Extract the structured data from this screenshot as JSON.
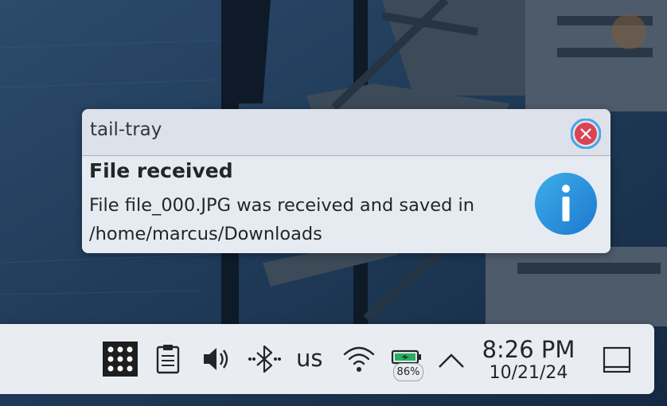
{
  "notification": {
    "app_name": "tail-tray",
    "title": "File received",
    "message": "File file_000.JPG was received and saved in /home/marcus/Downloads",
    "close_icon": "close-icon",
    "info_icon": "information-icon"
  },
  "panel": {
    "launcher_icon": "app-launcher-icon",
    "clipboard_icon": "clipboard-icon",
    "volume_icon": "volume-icon",
    "bluetooth_icon": "bluetooth-icon",
    "keyboard_layout": "us",
    "wifi_icon": "wifi-icon",
    "battery": {
      "percent_label": "86%",
      "charging": true
    },
    "expand_icon": "chevron-up-icon",
    "clock": {
      "time": "8:26 PM",
      "date": "10/21/24"
    },
    "show_desktop_icon": "show-desktop-icon"
  },
  "colors": {
    "info_blue": "#1d99f3",
    "close_red": "#da4453",
    "battery_green": "#27ae60",
    "panel_bg": "#e9edf2"
  }
}
